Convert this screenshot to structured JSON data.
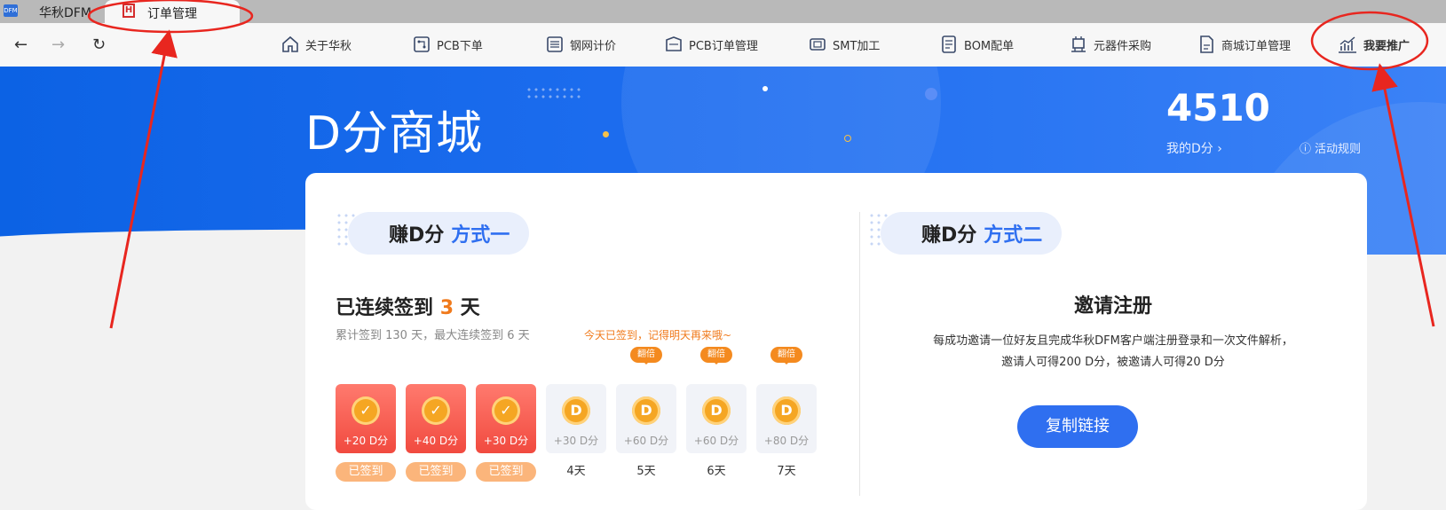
{
  "app": {
    "logo_text": "DFM",
    "name": "华秋DFM"
  },
  "tab": {
    "icon_text": "H",
    "label": "订单管理"
  },
  "nav": {
    "back": "←",
    "forward": "→",
    "refresh": "↻",
    "items": [
      {
        "label": "关于华秋",
        "icon": "home-icon"
      },
      {
        "label": "PCB下单",
        "icon": "pcb-icon"
      },
      {
        "label": "钢网计价",
        "icon": "stencil-icon"
      },
      {
        "label": "PCB订单管理",
        "icon": "pcb-order-icon"
      },
      {
        "label": "SMT加工",
        "icon": "chip-icon"
      },
      {
        "label": "BOM配单",
        "icon": "bom-list-icon"
      },
      {
        "label": "元器件采购",
        "icon": "component-icon"
      },
      {
        "label": "商城订单管理",
        "icon": "document-icon"
      },
      {
        "label": "我要推广",
        "icon": "chart-icon"
      }
    ]
  },
  "hero": {
    "title": "D分商城",
    "points": "4510",
    "my_points_label": "我的D分 ›",
    "rules_icon": "ⓘ",
    "rules_label": "活动规则"
  },
  "method1": {
    "prefix": "赚D分",
    "name": "方式一"
  },
  "method2": {
    "prefix": "赚D分",
    "name": "方式二"
  },
  "checkin": {
    "streak_prefix": "已连续签到",
    "streak_days": "3",
    "streak_suffix": "天",
    "summary": "累计签到 130 天，最大连续签到 6 天",
    "note": "今天已签到，记得明天再来哦~",
    "double_label": "翻倍",
    "days": [
      {
        "amount": "+20 D分",
        "label": "已签到",
        "done": true,
        "double": false
      },
      {
        "amount": "+40 D分",
        "label": "已签到",
        "done": true,
        "double": false
      },
      {
        "amount": "+30 D分",
        "label": "已签到",
        "done": true,
        "double": false
      },
      {
        "amount": "+30 D分",
        "label": "4天",
        "done": false,
        "double": false
      },
      {
        "amount": "+60 D分",
        "label": "5天",
        "done": false,
        "double": true
      },
      {
        "amount": "+60 D分",
        "label": "6天",
        "done": false,
        "double": true
      },
      {
        "amount": "+80 D分",
        "label": "7天",
        "done": false,
        "double": true
      }
    ],
    "coin_letter": "D"
  },
  "invite": {
    "title": "邀请注册",
    "desc_line1": "每成功邀请一位好友且完成华秋DFM客户端注册登录和一次文件解析，",
    "desc_line2": "邀请人可得200 D分，被邀请人可得20 D分",
    "button": "复制链接"
  },
  "colors": {
    "accent": "#2f6ff0",
    "orange": "#f07a1c",
    "annotation": "#e8261f"
  }
}
